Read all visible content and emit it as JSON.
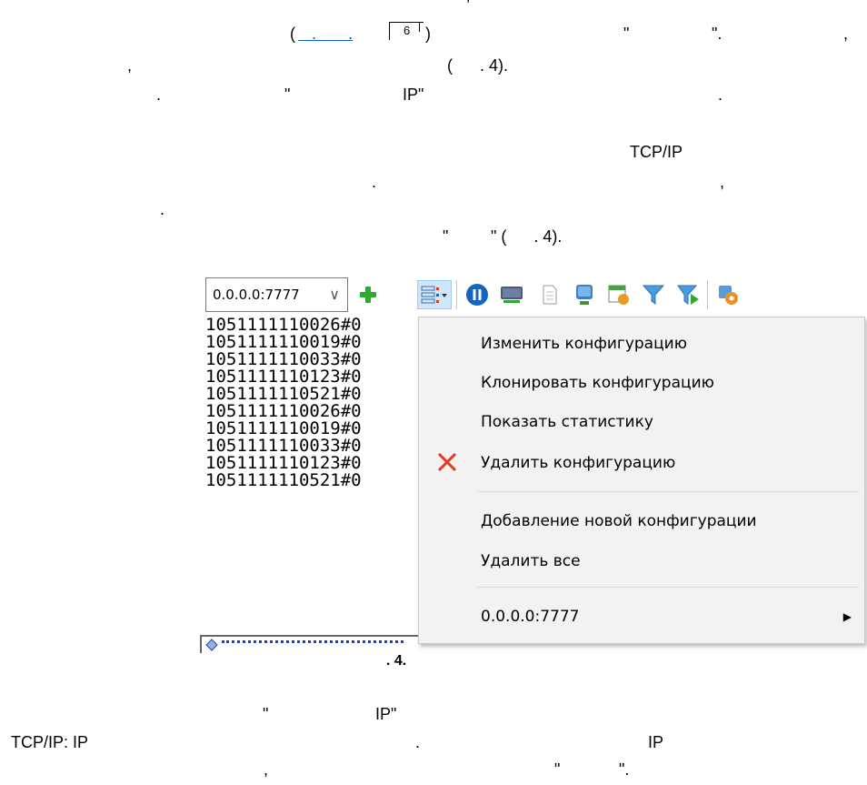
{
  "doc": {
    "para1": {
      "line1": ",",
      "line2_open": "(",
      "line2_link": "   .       .",
      "line2_ref": "6",
      "line2_close": ")",
      "line2_quote1": "\"",
      "line2_quote2": "\".",
      "line2_comma": ",",
      "line3_comma": ",",
      "line3_ref": "(      . 4).",
      "line4_dot": ".",
      "line4_quote": "\"",
      "line4_ip": "IP\"",
      "line4_end": "."
    },
    "para2": {
      "tcpip": "TCP/IP",
      "dot": ".",
      "comma": ",",
      "dot2": ".",
      "quote1": "\"",
      "quote2_ref": "\" (      . 4)."
    },
    "caption": ". 4.",
    "para3": {
      "quote": "\"",
      "ip": "IP\"",
      "tcpip_ip": "TCP/IP: IP",
      "dot": ".",
      "ip2": "IP",
      "comma": ",",
      "q1": "\"",
      "q2": "\"."
    }
  },
  "app": {
    "address_value": "0.0.0.0:7777",
    "toolbar_icons": [
      "add-icon",
      "config-menu-icon",
      "pause-icon",
      "device-icon",
      "document-icon",
      "monitor-icon",
      "schedule-icon",
      "filter-icon",
      "filter-apply-icon",
      "settings-icon"
    ],
    "log_lines": [
      "1051111110026#0",
      "1051111110019#0",
      "1051111110033#0",
      "1051111110123#0",
      "1051111110521#0",
      "1051111110026#0",
      "1051111110019#0",
      "1051111110033#0",
      "1051111110123#0",
      "1051111110521#0"
    ],
    "context_menu": {
      "edit": "Изменить конфигурацию",
      "clone": "Клонировать конфигурацию",
      "stats": "Показать статистику",
      "delete": "Удалить конфигурацию",
      "add_new": "Добавление новой конфигурации",
      "delete_all": "Удалить все",
      "submenu": "0.0.0.0:7777"
    },
    "colors": {
      "add_green": "#2eab2e",
      "delete_red": "#e33b1f",
      "pause_blue": "#1565c0",
      "link_blue": "#0b5bd3"
    }
  }
}
